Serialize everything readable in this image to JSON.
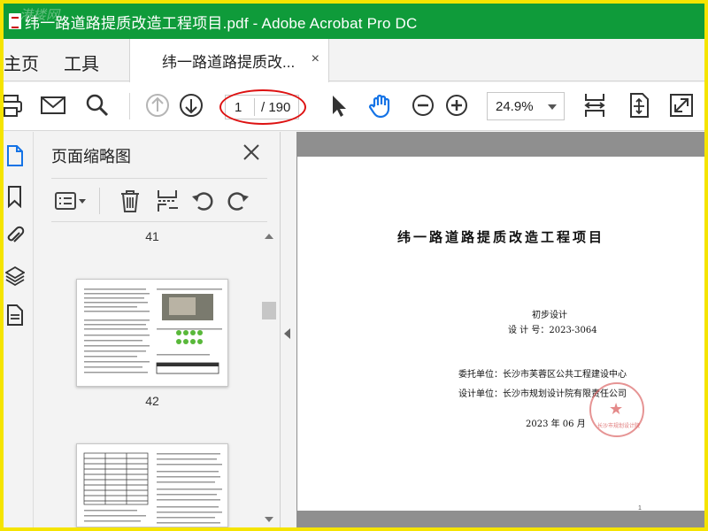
{
  "window": {
    "title": "纬一路道路提质改造工程项目.pdf - Adobe Acrobat Pro DC",
    "watermark": "港楼网"
  },
  "menu": {
    "home": "主页",
    "tools": "工具",
    "tab_label": "纬一路道路提质改...",
    "tab_close": "×"
  },
  "toolbar": {
    "current_page": "1",
    "total_pages": "/ 190",
    "zoom": "24.9%"
  },
  "thumbnails": {
    "panel_title": "页面缩略图",
    "labels": [
      "41",
      "42"
    ]
  },
  "document": {
    "title": "纬一路道路提质改造工程项目",
    "stage": "初步设计",
    "design_no": "设 计 号：2023-3064",
    "client": "委托单位：长沙市芙蓉区公共工程建设中心",
    "designer": "设计单位：长沙市规划设计院有限责任公司",
    "date": "2023 年 06 月",
    "stamp_text": "长沙市规划设计院",
    "page_number": "1"
  },
  "colors": {
    "frame": "#f5e400",
    "titlebar": "#0f9b3a",
    "accent_blue": "#1473e6",
    "circle_red": "#d11111",
    "stamp_red": "#d23c3c"
  }
}
